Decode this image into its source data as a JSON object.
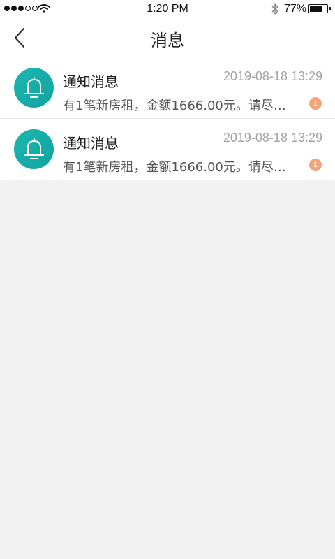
{
  "status_bar": {
    "time": "1:20 PM",
    "battery_percent": "77%",
    "battery_level": 0.77,
    "signal_bars_filled": 3,
    "signal_bars_total": 5,
    "icons": [
      "signal-icon",
      "wifi-icon",
      "bluetooth-icon",
      "battery-icon"
    ]
  },
  "nav": {
    "title": "消息",
    "back_icon": "chevron-left-icon"
  },
  "messages": [
    {
      "title": "通知消息",
      "time": "2019-08-18 13:29",
      "body": "有1笔新房租，金额1666.00元。请尽…",
      "badge": "1",
      "icon": "bell-icon"
    },
    {
      "title": "通知消息",
      "time": "2019-08-18 13:29",
      "body": "有1笔新房租，金额1666.00元。请尽…",
      "badge": "1",
      "icon": "bell-icon"
    }
  ],
  "colors": {
    "accent": "#1bb7b0",
    "badge": "#f3a47a",
    "background": "#f1f1f1",
    "timestamp": "#a3a3a3"
  }
}
